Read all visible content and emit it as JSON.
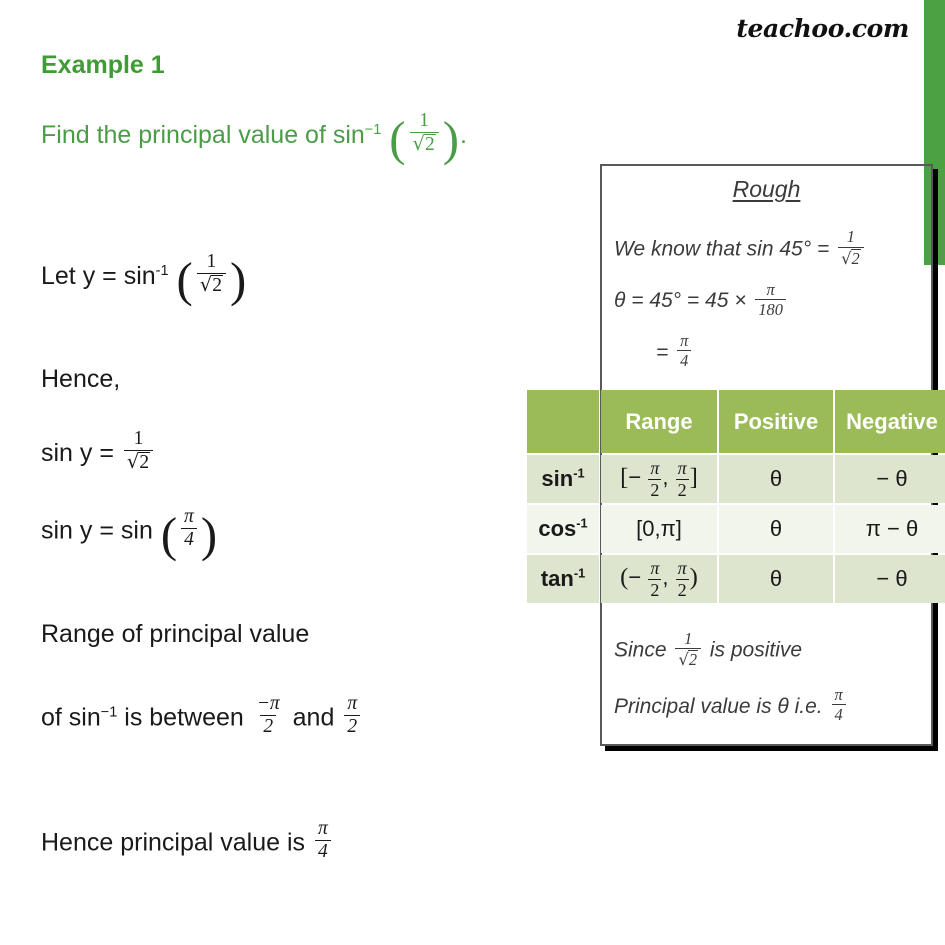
{
  "brand": {
    "name": "teachoo.com"
  },
  "colors": {
    "heading_green": "#3f9c35",
    "question_green": "#4a9c47",
    "edge_bar_green": "#4ca143",
    "table_header_green": "#9bbb59",
    "table_row_odd": "#dde5ce",
    "table_row_even": "#f2f5ec",
    "box_border": "#595959",
    "body_text": "#1a1a1a"
  },
  "lesson": {
    "example_title": "Example 1",
    "question_prefix": "Find the principal value of sin",
    "question_exponent": "−1",
    "question_fraction_num": "1",
    "question_fraction_den_root": "2",
    "question_suffix": "."
  },
  "steps": {
    "let_label": "Let y = sin",
    "let_exponent": "-1",
    "let_num": "1",
    "let_den_root": "2",
    "hence": "Hence,",
    "sin_y_label": "sin y =",
    "sin_y_num": "1",
    "sin_y_den_root": "2",
    "sin_y_sin_label": "sin y = sin",
    "sin_y_sin_num": "π",
    "sin_y_sin_den": "4",
    "range_line1": "Range of principal value",
    "range_line2_a": "of sin",
    "range_line2_exp": "−1",
    "range_line2_b": "is between",
    "range_low_num": "−π",
    "range_low_den": "2",
    "range_and": "and",
    "range_high_num": "π",
    "range_high_den": "2",
    "final_label": "Hence principal value is",
    "final_num": "π",
    "final_den": "4"
  },
  "rough": {
    "title": "Rough",
    "line1_a": "We know that sin 45° =",
    "line1_num": "1",
    "line1_den_root": "2",
    "line2_a": "θ = 45° = 45",
    "line2_times": "×",
    "line2_num": "π",
    "line2_den": "180",
    "line3_eq": "=",
    "line3_num": "π",
    "line3_den": "4",
    "foot1_a": "Since",
    "foot1_num": "1",
    "foot1_den_root": "2",
    "foot1_b": "is positive",
    "foot2_a": "Principal value is θ i.e.",
    "foot2_num": "π",
    "foot2_den": "4"
  },
  "table": {
    "headers": [
      "",
      "Range",
      "Positive",
      "Negative"
    ],
    "rows": [
      {
        "function": "sin",
        "function_exp": "-1",
        "range_open": "[",
        "range_close": "]",
        "range_left_sign": "−",
        "range_left_num": "π",
        "range_left_den": "2",
        "range_sep": ",",
        "range_right_num": "π",
        "range_right_den": "2",
        "range_plain": "",
        "positive": "θ",
        "negative": "− θ"
      },
      {
        "function": "cos",
        "function_exp": "-1",
        "range_plain": "[0,π]",
        "positive": "θ",
        "negative": "π − θ"
      },
      {
        "function": "tan",
        "function_exp": "-1",
        "range_open": "(",
        "range_close": ")",
        "range_left_sign": "−",
        "range_left_num": "π",
        "range_left_den": "2",
        "range_sep": ",",
        "range_right_num": "π",
        "range_right_den": "2",
        "range_plain": "",
        "positive": "θ",
        "negative": "− θ"
      }
    ]
  }
}
